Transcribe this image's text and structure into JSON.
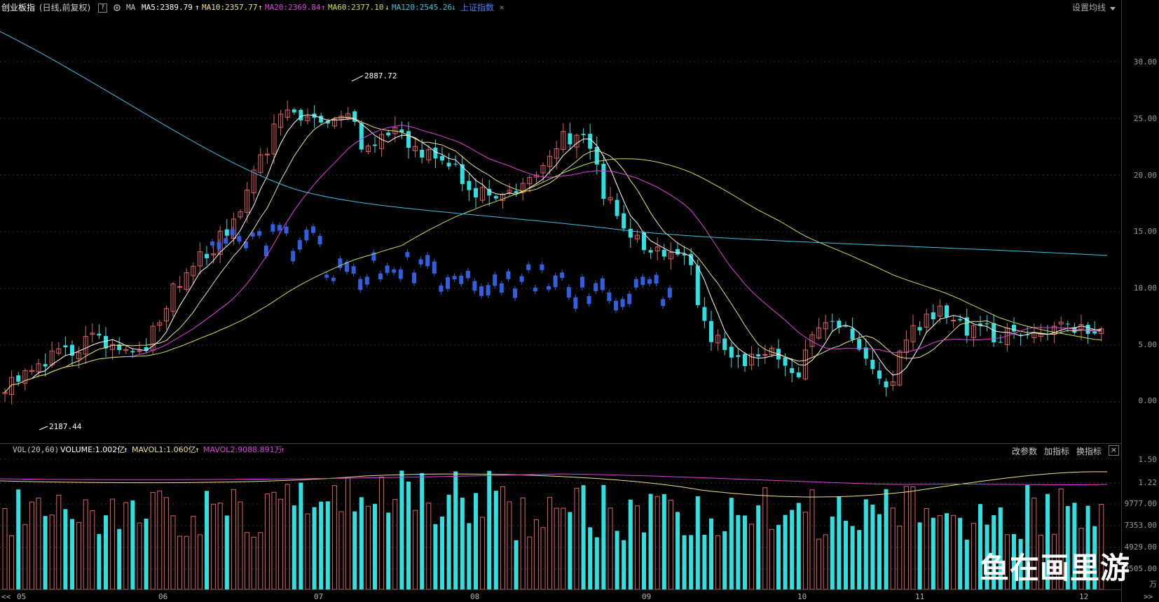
{
  "header": {
    "index_name": "创业板指",
    "period": "(日线,前复权)",
    "help_icon": "?",
    "settings_icon": "gear-icon",
    "ma_label": "MA",
    "ma5": "MA5:2389.79",
    "ma10": "MA10:2357.77",
    "ma20": "MA20:2369.84",
    "ma60": "MA60:2377.10",
    "ma120": "MA120:2545.26",
    "arrow_up": "↑",
    "arrow_down": "↓",
    "overlay_index": "上证指数",
    "close_x": "×",
    "settings_button": "设置均线",
    "colors": {
      "ma5": "#ffffff",
      "ma10": "#f2e08a",
      "ma20": "#e040e0",
      "ma60": "#c8e050",
      "ma120": "#40c0e0",
      "overlay": "#4080ff"
    }
  },
  "price_axis": [
    "30.00",
    "25.00",
    "20.00",
    "15.00",
    "10.00",
    "5.00",
    "0.00"
  ],
  "annotations": {
    "high": "2887.72",
    "low": "2187.44"
  },
  "volume_header": {
    "label": "VOL(20,60)",
    "volume": "VOLUME:1.002亿",
    "mavol1": "MAVOL1:1.060亿",
    "mavol2": "MAVOL2:9088.891万",
    "arrow_up": "↑"
  },
  "volume_buttons": {
    "change_params": "改参数",
    "add_indicator": "加指标",
    "switch_indicator": "换指标",
    "close": "×"
  },
  "volume_axis": [
    "1.50",
    "1.22",
    "9777.00",
    "7353.00",
    "4929.00",
    "2505.00",
    "万"
  ],
  "time_axis": [
    "05",
    "06",
    "07",
    "08",
    "09",
    "10",
    "11",
    "12"
  ],
  "nav_arrows": {
    "left": "<<",
    "right": ">>"
  },
  "watermark": "鱼在画里游"
}
